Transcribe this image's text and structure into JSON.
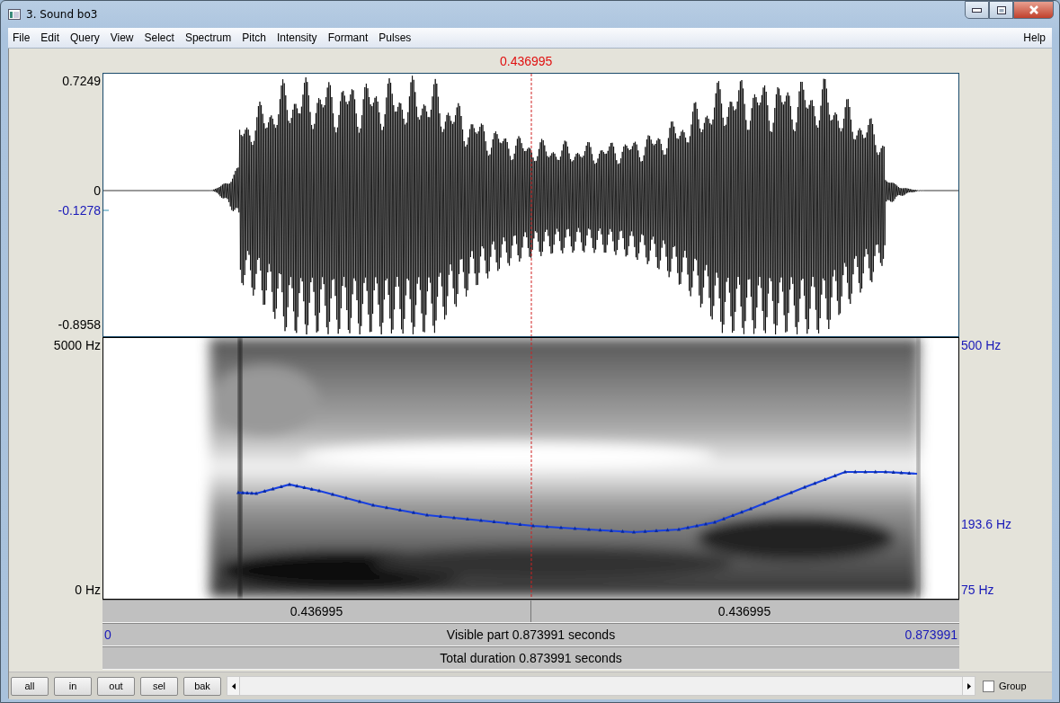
{
  "window": {
    "title": "3. Sound bo3"
  },
  "menu": [
    "File",
    "Edit",
    "Query",
    "View",
    "Select",
    "Spectrum",
    "Pitch",
    "Intensity",
    "Formant",
    "Pulses"
  ],
  "help": "Help",
  "cursor": {
    "time": "0.436995"
  },
  "waveform": {
    "y_max": "0.7249",
    "zero": "0",
    "cursor_value": "-0.1278",
    "y_min": "-0.8958"
  },
  "spectrogram": {
    "top_label": "5000 Hz",
    "bottom_label": "0 Hz"
  },
  "pitch": {
    "top_label": "500 Hz",
    "value_label": "193.6 Hz",
    "bottom_label": "75 Hz"
  },
  "time_bars": {
    "left_segment": "0.436995",
    "right_segment": "0.436995",
    "start": "0",
    "visible": "Visible part 0.873991 seconds",
    "end": "0.873991",
    "total": "Total duration 0.873991 seconds"
  },
  "buttons": [
    "all",
    "in",
    "out",
    "sel",
    "bak"
  ],
  "group": {
    "label": "Group",
    "checked": false
  }
}
